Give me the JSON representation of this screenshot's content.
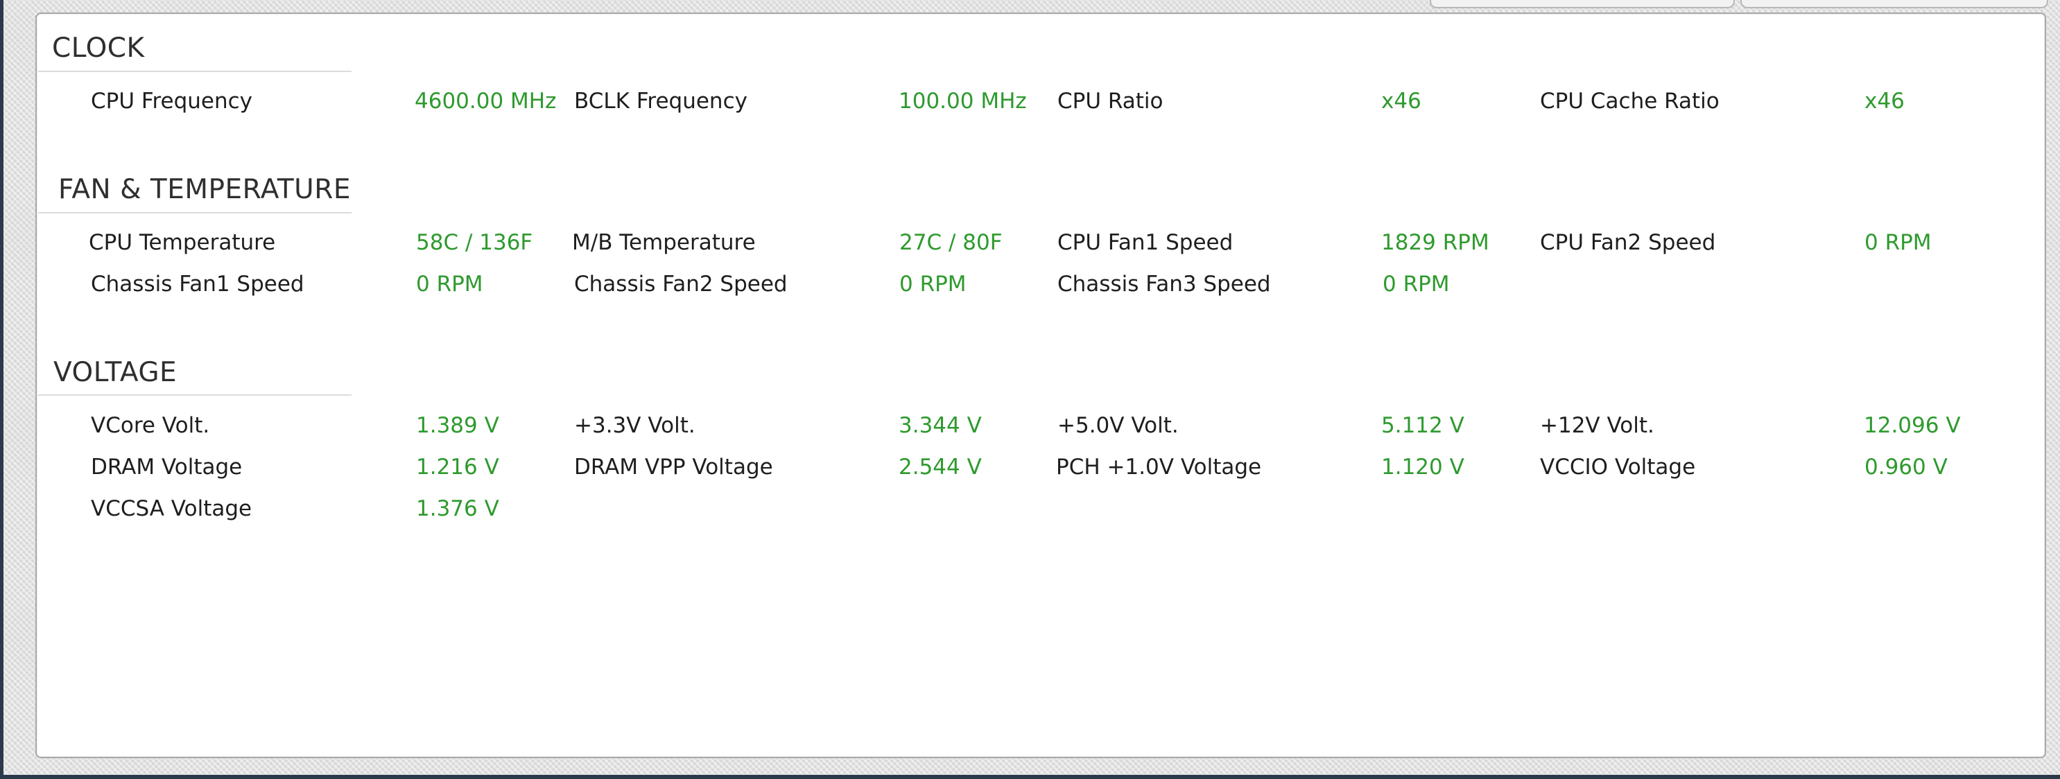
{
  "sections": {
    "clock": {
      "title": "CLOCK",
      "rows": [
        [
          {
            "label": "CPU Frequency",
            "value": "4600.00 MHz"
          },
          {
            "label": "BCLK Frequency",
            "value": "100.00 MHz"
          },
          {
            "label": "CPU Ratio",
            "value": "x46"
          },
          {
            "label": "CPU Cache Ratio",
            "value": "x46"
          }
        ]
      ]
    },
    "fan_temp": {
      "title": "FAN & TEMPERATURE",
      "rows": [
        [
          {
            "label": "CPU Temperature",
            "value": "58C / 136F"
          },
          {
            "label": "M/B Temperature",
            "value": "27C / 80F"
          },
          {
            "label": "CPU Fan1 Speed",
            "value": "1829 RPM"
          },
          {
            "label": "CPU Fan2 Speed",
            "value": "0 RPM"
          }
        ],
        [
          {
            "label": "Chassis Fan1 Speed",
            "value": "0 RPM"
          },
          {
            "label": "Chassis Fan2 Speed",
            "value": "0 RPM"
          },
          {
            "label": "Chassis Fan3 Speed",
            "value": "0 RPM"
          }
        ]
      ]
    },
    "voltage": {
      "title": "VOLTAGE",
      "rows": [
        [
          {
            "label": "VCore Volt.",
            "value": "1.389 V"
          },
          {
            "label": "+3.3V Volt.",
            "value": "3.344 V"
          },
          {
            "label": "+5.0V Volt.",
            "value": "5.112 V"
          },
          {
            "label": "+12V Volt.",
            "value": "12.096 V"
          }
        ],
        [
          {
            "label": "DRAM Voltage",
            "value": "1.216 V"
          },
          {
            "label": "DRAM VPP Voltage",
            "value": "2.544 V"
          },
          {
            "label": "PCH +1.0V Voltage",
            "value": "1.120 V"
          },
          {
            "label": "VCCIO Voltage",
            "value": "0.960 V"
          }
        ],
        [
          {
            "label": "VCCSA Voltage",
            "value": "1.376 V"
          }
        ]
      ]
    }
  },
  "colors": {
    "label": "#1e1e1e",
    "value": "#2e9a2e",
    "section_title": "#2f2f2f",
    "panel_background": "#ffffff"
  }
}
